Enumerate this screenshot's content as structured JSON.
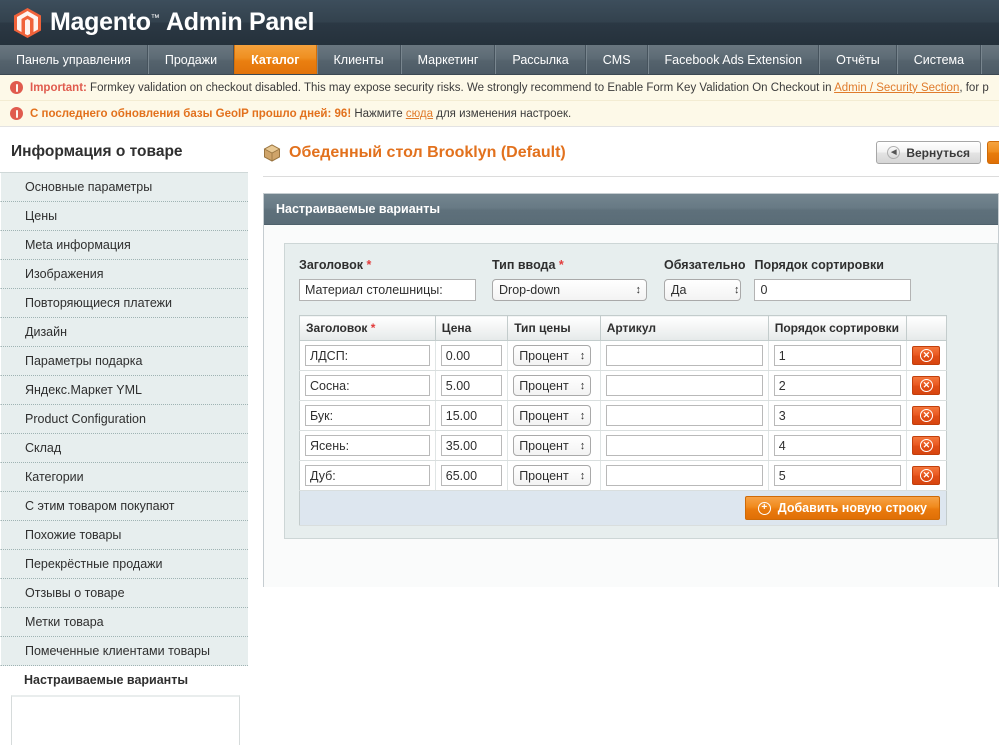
{
  "header": {
    "logo_icon": "magento-hexagon-icon",
    "brand": "Magento",
    "trademark": "™",
    "subtitle": "Admin Panel"
  },
  "nav": {
    "items": [
      {
        "label": "Панель управления",
        "active": false
      },
      {
        "label": "Продажи",
        "active": false
      },
      {
        "label": "Каталог",
        "active": true
      },
      {
        "label": "Клиенты",
        "active": false
      },
      {
        "label": "Маркетинг",
        "active": false
      },
      {
        "label": "Рассылка",
        "active": false
      },
      {
        "label": "CMS",
        "active": false
      },
      {
        "label": "Facebook Ads Extension",
        "active": false
      },
      {
        "label": "Отчёты",
        "active": false
      },
      {
        "label": "Система",
        "active": false
      }
    ]
  },
  "messages": [
    {
      "icon": "warning-icon",
      "bold_prefix": "Important:",
      "text_before_link": " Formkey validation on checkout disabled. This may expose security risks. We strongly recommend to Enable Form Key Validation On Checkout in ",
      "link": "Admin / Security Section",
      "text_after_link": ", for p"
    },
    {
      "icon": "warning-icon",
      "bold_prefix": "С последнего обновления базы GeoIP прошло дней: 96!",
      "text_before_link": " Нажмите ",
      "link": "сюда",
      "text_after_link": " для изменения настроек."
    }
  ],
  "sidebar": {
    "title": "Информация о товаре",
    "items": [
      {
        "label": "Основные параметры",
        "active": false
      },
      {
        "label": "Цены",
        "active": false
      },
      {
        "label": "Meta информация",
        "active": false
      },
      {
        "label": "Изображения",
        "active": false
      },
      {
        "label": "Повторяющиеся платежи",
        "active": false
      },
      {
        "label": "Дизайн",
        "active": false
      },
      {
        "label": "Параметры подарка",
        "active": false
      },
      {
        "label": "Яндекс.Маркет YML",
        "active": false
      },
      {
        "label": "Product Configuration",
        "active": false
      },
      {
        "label": "Склад",
        "active": false
      },
      {
        "label": "Категории",
        "active": false
      },
      {
        "label": "С этим товаром покупают",
        "active": false
      },
      {
        "label": "Похожие товары",
        "active": false
      },
      {
        "label": "Перекрёстные продажи",
        "active": false
      },
      {
        "label": "Отзывы о товаре",
        "active": false
      },
      {
        "label": "Метки товара",
        "active": false
      },
      {
        "label": "Помеченные клиентами товары",
        "active": false
      },
      {
        "label": "Настраиваемые варианты",
        "active": true
      }
    ]
  },
  "content": {
    "page_icon": "product-box-icon",
    "page_title": "Обеденный стол Brooklyn (Default)",
    "back_button": "Вернуться",
    "back_icon": "back-arrow-icon",
    "panel_title": "Настраиваемые варианты"
  },
  "option": {
    "labels": {
      "title": "Заголовок",
      "input_type": "Тип ввода",
      "required": "Обязательно",
      "sort_order": "Порядок сортировки",
      "required_marker": "*"
    },
    "values": {
      "title": "Материал столешницы:",
      "input_type": "Drop-down",
      "required": "Да",
      "sort_order": "0"
    },
    "input_type_options": [
      "Drop-down"
    ],
    "required_options": [
      "Да"
    ]
  },
  "values_table": {
    "columns": [
      {
        "label": "Заголовок",
        "required": true
      },
      {
        "label": "Цена",
        "required": false
      },
      {
        "label": "Тип цены",
        "required": false
      },
      {
        "label": "Артикул",
        "required": false
      },
      {
        "label": "Порядок сортировки",
        "required": false
      },
      {
        "label": "",
        "required": false
      }
    ],
    "price_type_options": [
      "Процент"
    ],
    "rows": [
      {
        "title": "ЛДСП:",
        "price": "0.00",
        "price_type": "Процент",
        "sku": "",
        "sort_order": "1",
        "delete_icon": "delete-circle-icon"
      },
      {
        "title": "Сосна:",
        "price": "5.00",
        "price_type": "Процент",
        "sku": "",
        "sort_order": "2",
        "delete_icon": "delete-circle-icon"
      },
      {
        "title": "Бук:",
        "price": "15.00",
        "price_type": "Процент",
        "sku": "",
        "sort_order": "3",
        "delete_icon": "delete-circle-icon"
      },
      {
        "title": "Ясень:",
        "price": "35.00",
        "price_type": "Процент",
        "sku": "",
        "sort_order": "4",
        "delete_icon": "delete-circle-icon"
      },
      {
        "title": "Дуб:",
        "price": "65.00",
        "price_type": "Процент",
        "sku": "",
        "sort_order": "5",
        "delete_icon": "delete-circle-icon"
      }
    ],
    "add_row_button": "Добавить новую строку",
    "add_row_icon": "plus-circle-icon"
  },
  "colors": {
    "accent_orange": "#e2711d",
    "header_dark": "#2b3844",
    "nav_grey": "#5d6b75",
    "panel_header": "#687a85",
    "sidebar_item_bg": "#e7eeee",
    "danger_red": "#e05b4e",
    "delete_button": "#e04d16",
    "table_footer": "#dde6ef"
  }
}
